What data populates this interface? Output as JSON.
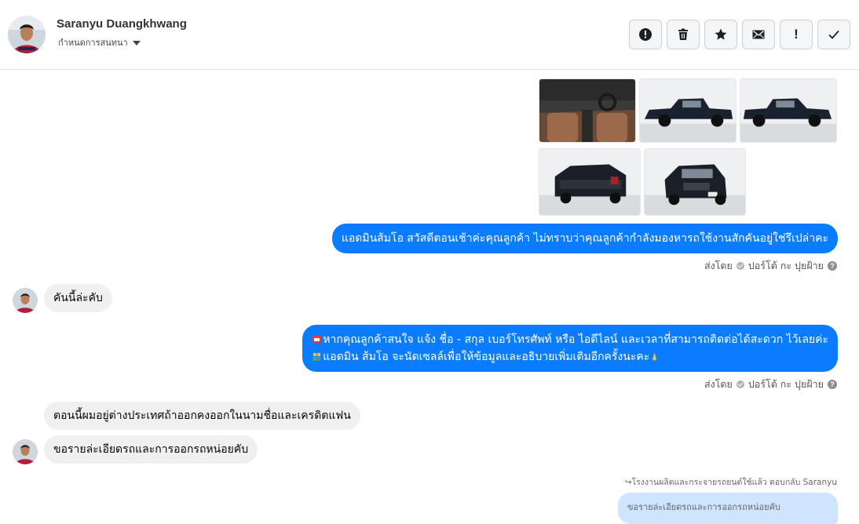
{
  "header": {
    "contact_name": "Saranyu Duangkhwang",
    "assign_label": "กำหนดการสนทนา",
    "toolbar": [
      {
        "name": "spam-button",
        "icon": "alert-circle-icon"
      },
      {
        "name": "delete-button",
        "icon": "trash-icon"
      },
      {
        "name": "star-button",
        "icon": "star-icon"
      },
      {
        "name": "mark-unread-button",
        "icon": "envelope-icon"
      },
      {
        "name": "follow-up-button",
        "icon": "exclamation-icon"
      },
      {
        "name": "mark-done-button",
        "icon": "checkmark-icon"
      }
    ]
  },
  "messages": [
    {
      "kind": "outgoing",
      "text": "แอดมินส้มโอ สวัสดีตอนเช้าค่ะคุณลูกค้า ไม่ทราบว่าคุณลูกค้ากำลังมองหารถใช้งานสักคันอยู่ใช่รึเปล่าคะ"
    },
    {
      "kind": "incoming",
      "text": "คันนี้ล่ะคับ"
    },
    {
      "kind": "outgoing",
      "line1": "หากคุณลูกค้าสนใจ แจ้ง ชื่อ - สกุล เบอร์โทรศัพท์ หรือ ไอดีไลน์ และเวลาที่สามารถติดต่อได้สะดวก ไว้เลยค่ะ",
      "line2": "แอดมิน ส้มโอ จะนัดเซลล์เพื่อให้ข้อมูลและอธิบายเพิ่มเติมอีกครั้งนะคะ"
    },
    {
      "kind": "incoming",
      "text": "ตอนนี้ผมอยู่ต่างประเทศถ้าออกคงออกในนามชื่อและเครดิตแฟน"
    },
    {
      "kind": "incoming",
      "text": "ขอรายล่ะเอียดรถและการออกรถหน่อยคับ"
    }
  ],
  "sent_by": {
    "label": "ส่งโดย",
    "sender": "ปอร์โต้ กะ ปุยฝ้าย",
    "help": "?"
  },
  "reply": {
    "note": "↪โรงงานผลิตและกระจายรถยนต์ใช้แล้ว ตอบกลับ Saranyu",
    "quote": "ขอรายล่ะเอียดรถและการออกรถหน่อยคับ"
  },
  "colors": {
    "outgoing_bubble": "#0a7cff",
    "incoming_bubble": "#f0f0f0",
    "reply_quote": "#cfe4ff"
  }
}
